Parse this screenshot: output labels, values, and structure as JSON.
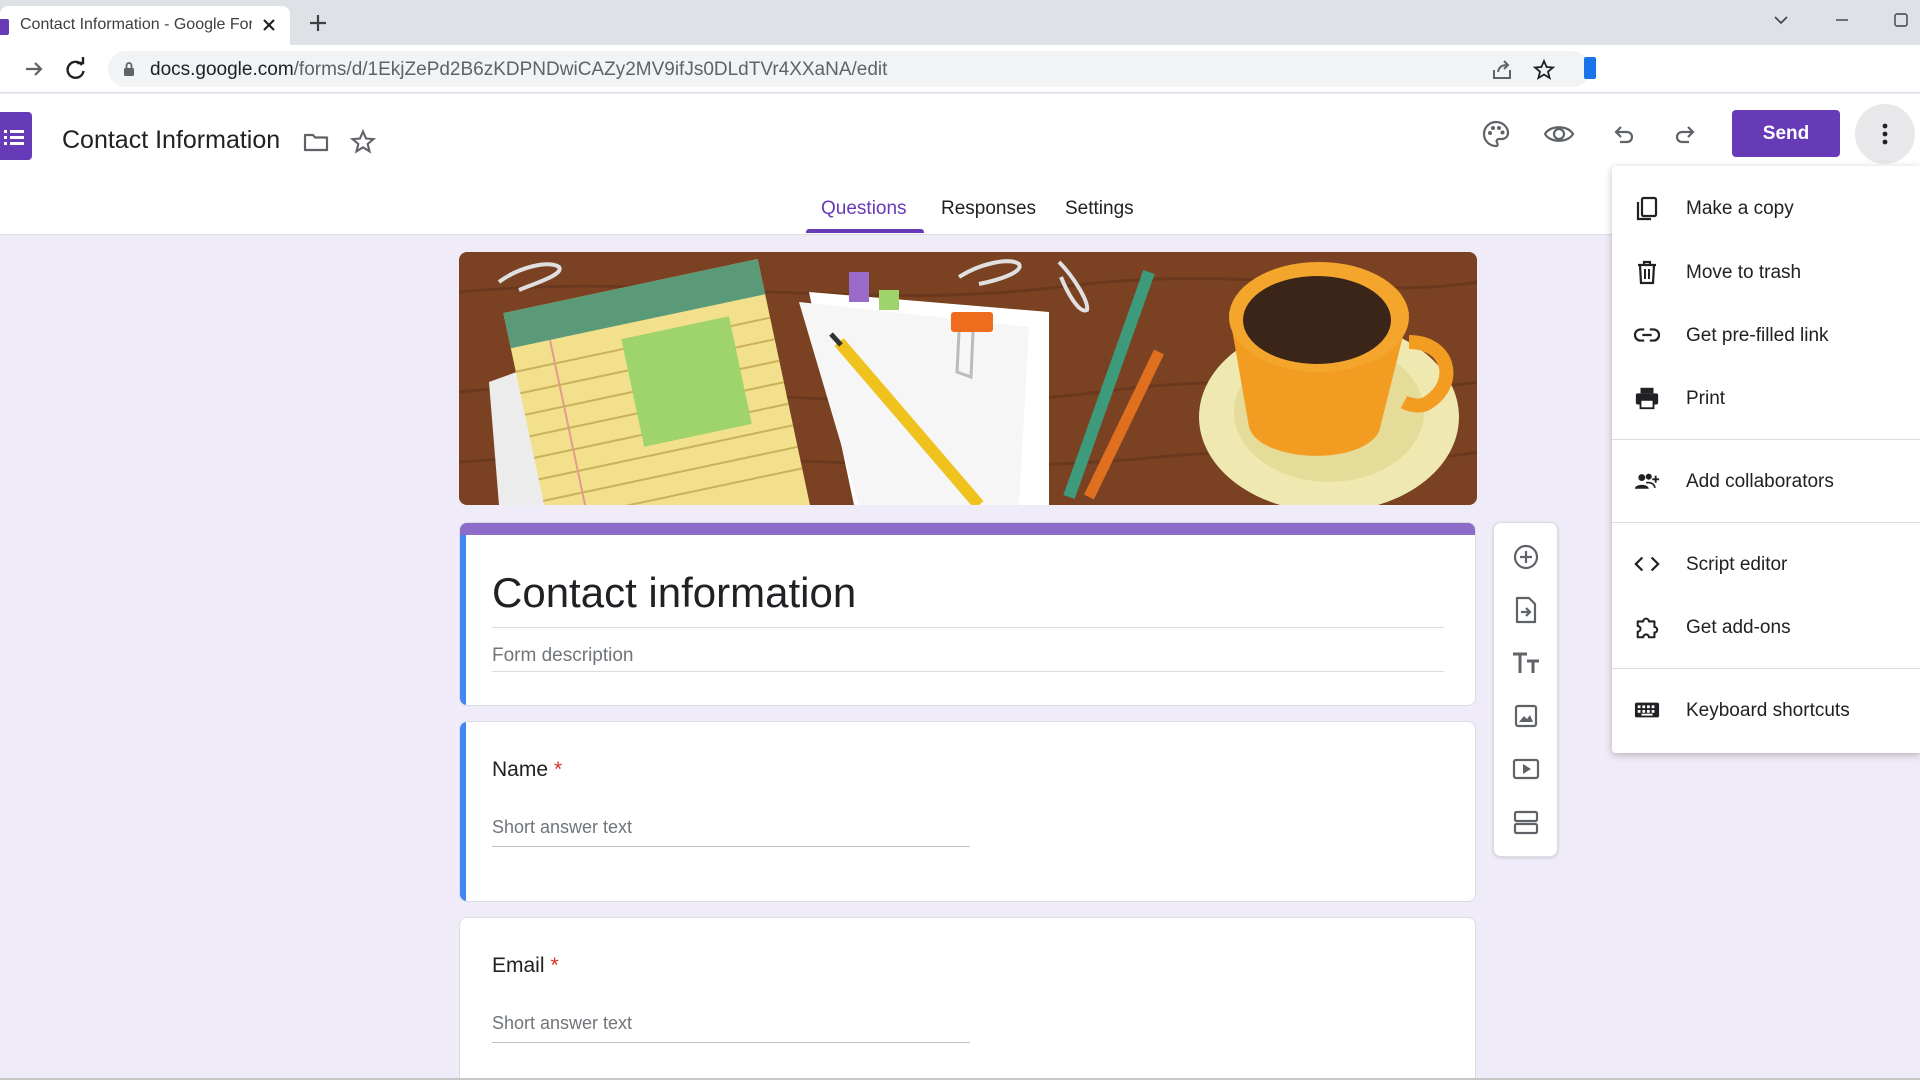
{
  "browser": {
    "tab_title": "Contact Information - Google Forms",
    "url_host": "docs.google.com",
    "url_path": "/forms/d/1EkjZePd2B6zKDPNDwiCAZy2MV9ifJs0DLdTVr4XXaNA/edit"
  },
  "header": {
    "doc_title": "Contact Information",
    "send_label": "Send"
  },
  "tabs": [
    "Questions",
    "Responses",
    "Settings"
  ],
  "form": {
    "title": "Contact information",
    "description_placeholder": "Form description",
    "questions": [
      {
        "label": "Name",
        "required_mark": "*",
        "answer_placeholder": "Short answer text"
      },
      {
        "label": "Email",
        "required_mark": "*",
        "answer_placeholder": "Short answer text"
      }
    ]
  },
  "menu": {
    "items": [
      {
        "label": "Make a copy",
        "icon": "copy-icon"
      },
      {
        "label": "Move to trash",
        "icon": "trash-icon"
      },
      {
        "label": "Get pre-filled link",
        "icon": "link-icon"
      },
      {
        "label": "Print",
        "icon": "print-icon"
      },
      {
        "label": "Add collaborators",
        "icon": "people-add-icon"
      },
      {
        "label": "Script editor",
        "icon": "code-icon"
      },
      {
        "label": "Get add-ons",
        "icon": "puzzle-icon"
      },
      {
        "label": "Keyboard shortcuts",
        "icon": "keyboard-icon"
      }
    ]
  },
  "colors": {
    "accent": "#673ab7",
    "active_question": "#4285f4",
    "background": "#f0ebf8",
    "required": "#d93025"
  }
}
